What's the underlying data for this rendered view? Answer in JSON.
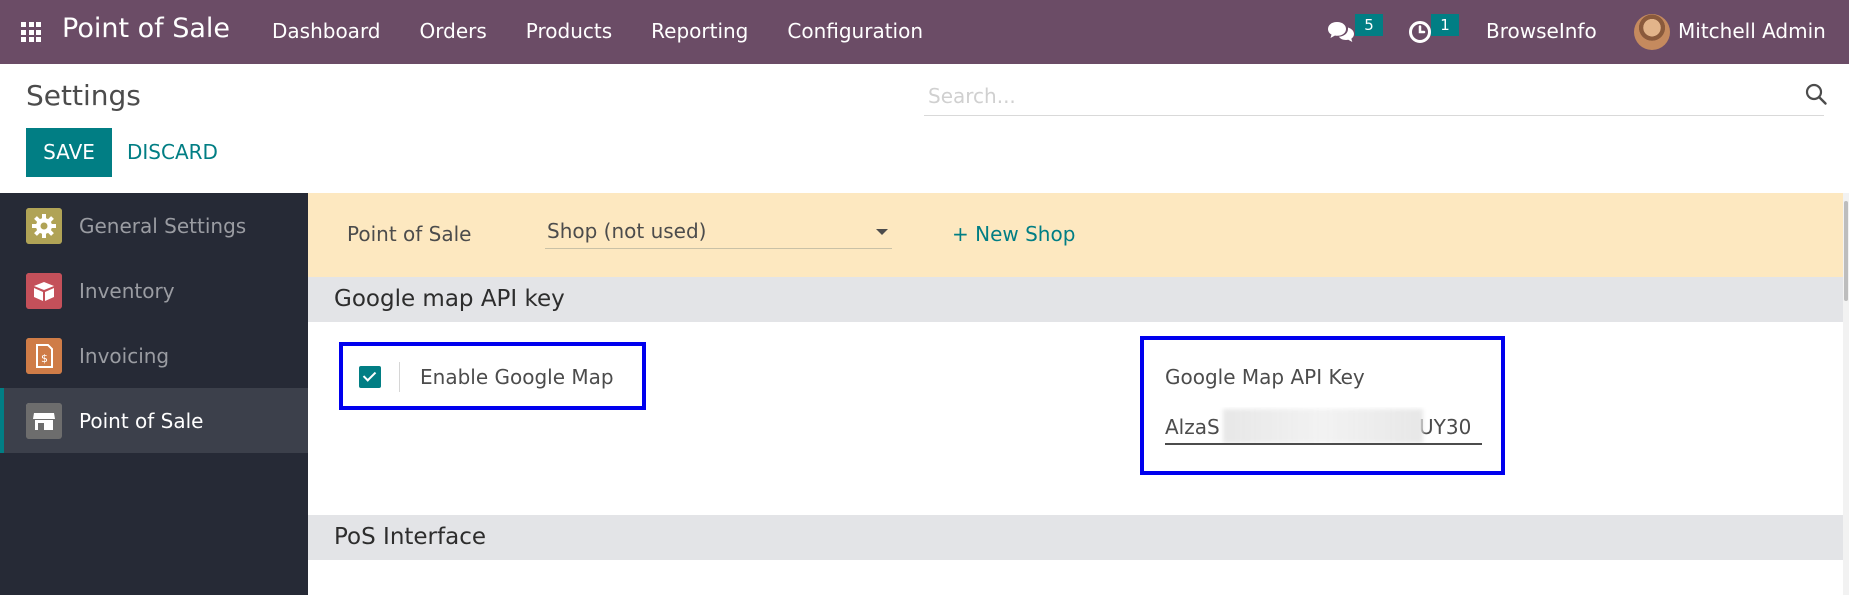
{
  "navbar": {
    "apps_icon": "grid-icon",
    "brand": "Point of Sale",
    "menu": [
      "Dashboard",
      "Orders",
      "Products",
      "Reporting",
      "Configuration"
    ],
    "messages_icon": "chat-icon",
    "messages_count": "5",
    "activities_icon": "clock-icon",
    "activities_count": "1",
    "company": "BrowseInfo",
    "user": "Mitchell Admin",
    "bg_color": "#6b4c66"
  },
  "control_panel": {
    "title": "Settings",
    "search_placeholder": "Search...",
    "search_icon": "search-icon",
    "save_label": "SAVE",
    "discard_label": "DISCARD",
    "accent_color": "#017e84"
  },
  "sidebar": {
    "items": [
      {
        "label": "General Settings",
        "icon": "gear-icon",
        "active": false
      },
      {
        "label": "Inventory",
        "icon": "box-icon",
        "active": false
      },
      {
        "label": "Invoicing",
        "icon": "invoice-icon",
        "active": false
      },
      {
        "label": "Point of Sale",
        "icon": "store-icon",
        "active": true
      }
    ]
  },
  "main": {
    "shop_bar": {
      "label": "Point of Sale",
      "selected_shop": "Shop (not used)",
      "new_shop_label": "+ New Shop",
      "bg_color": "#fde8c0"
    },
    "sections": [
      {
        "title": "Google map API key"
      },
      {
        "title": "PoS Interface"
      }
    ],
    "google_map": {
      "enable_label": "Enable Google Map",
      "enabled": true,
      "api_key_label": "Google Map API Key",
      "api_key_prefix": "AlzaS",
      "api_key_suffix": "UY30"
    },
    "highlight_color": "#0000ee"
  }
}
